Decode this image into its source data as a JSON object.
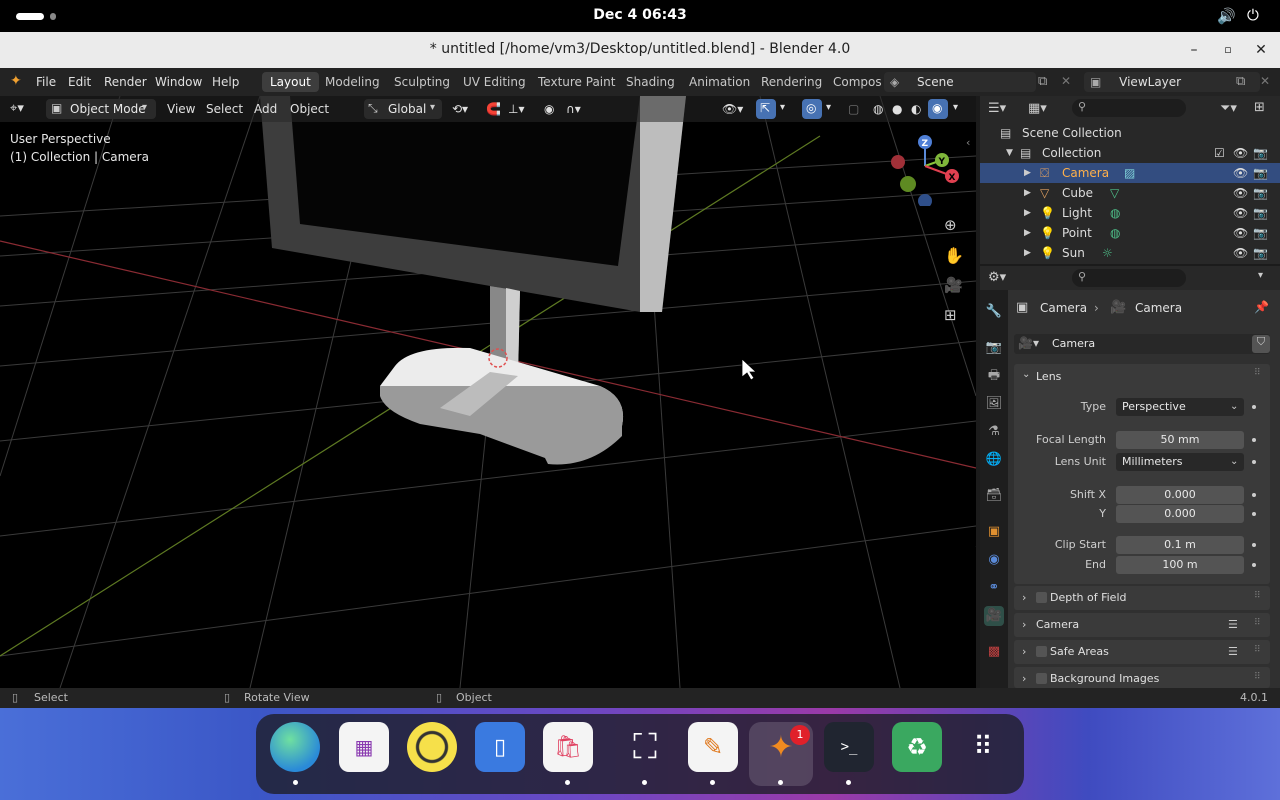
{
  "system": {
    "clock": "Dec 4  06:43"
  },
  "window": {
    "title": "* untitled [/home/vm3/Desktop/untitled.blend] - Blender 4.0"
  },
  "menus": [
    "File",
    "Edit",
    "Render",
    "Window",
    "Help"
  ],
  "workspaces": [
    "Layout",
    "Modeling",
    "Sculpting",
    "UV Editing",
    "Texture Paint",
    "Shading",
    "Animation",
    "Rendering",
    "Compos"
  ],
  "scene": {
    "name": "Scene",
    "view_layer": "ViewLayer"
  },
  "viewport": {
    "mode": "Object Mode",
    "menus": [
      "View",
      "Select",
      "Add",
      "Object"
    ],
    "transform": "Global",
    "overlay_text": "User Perspective",
    "overlay_text2": "(1) Collection | Camera",
    "gizmo": {
      "x": "X",
      "y": "Y",
      "z": "Z"
    }
  },
  "outliner": {
    "root": "Scene Collection",
    "collection": "Collection",
    "items": [
      "Camera",
      "Cube",
      "Light",
      "Point",
      "Sun"
    ]
  },
  "properties": {
    "breadcrumb1": "Camera",
    "breadcrumb2": "Camera",
    "data_name": "Camera",
    "lens_header": "Lens",
    "type_label": "Type",
    "type_value": "Perspective",
    "focal_label": "Focal Length",
    "focal_value": "50 mm",
    "unit_label": "Lens Unit",
    "unit_value": "Millimeters",
    "shiftx_label": "Shift X",
    "shiftx_value": "0.000",
    "y_label": "Y",
    "y_value": "0.000",
    "clipstart_label": "Clip Start",
    "clipstart_value": "0.1 m",
    "end_label": "End",
    "end_value": "100 m",
    "panels": [
      "Depth of Field",
      "Camera",
      "Safe Areas",
      "Background Images"
    ]
  },
  "status": {
    "select": "Select",
    "rotate": "Rotate View",
    "object": "Object",
    "version": "4.0.1"
  },
  "dock": {
    "badge": "1"
  }
}
